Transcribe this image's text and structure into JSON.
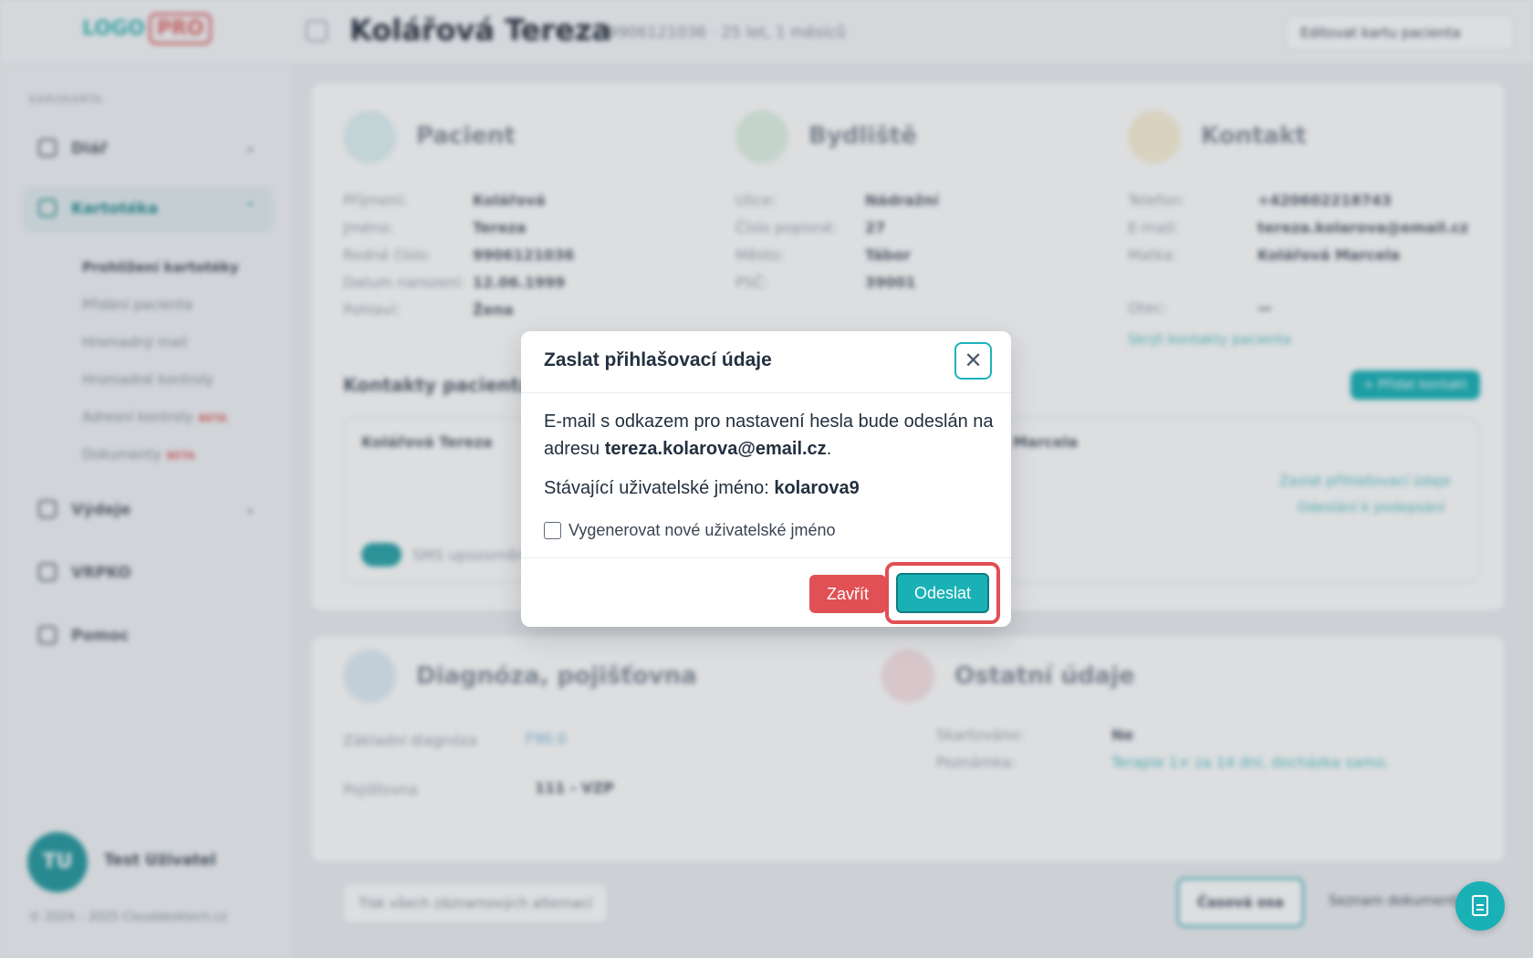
{
  "app": {
    "logo": "LOGO",
    "logo_badge": "PRO",
    "patient_name": "Kolářová Tereza",
    "patient_sub": "9906121036 · 25 let, 1 měsíců",
    "edit_button": "Editovat kartu pacienta"
  },
  "sidebar": {
    "section_label": "KAROKARTA",
    "items": [
      {
        "label": "Diář"
      },
      {
        "label": "Kartotéka"
      },
      {
        "label": "Výdeje"
      },
      {
        "label": "VRPKO"
      },
      {
        "label": "Pomoc"
      }
    ],
    "subitems": [
      {
        "label": "Prohlížení kartotéky"
      },
      {
        "label": "Přidání pacienta"
      },
      {
        "label": "Hromadný mail"
      },
      {
        "label": "Hromadné kontroly"
      },
      {
        "label": "Adresní kontroly",
        "badge": "BETA"
      },
      {
        "label": "Dokumenty",
        "badge": "BETA"
      }
    ],
    "user_initials": "TU",
    "user_name": "Test Uživatel",
    "copyright": "© 2024 – 2025 Clouddesktech.cz"
  },
  "main": {
    "patient_section": {
      "title": "Pacient",
      "rows": [
        {
          "k": "Příjmení:",
          "v": "Kolářová"
        },
        {
          "k": "Jméno:",
          "v": "Tereza"
        },
        {
          "k": "Rodné číslo:",
          "v": "9906121036"
        },
        {
          "k": "Datum narození:",
          "v": "12.06.1999"
        },
        {
          "k": "Pohlaví:",
          "v": "Žena"
        }
      ]
    },
    "address_section": {
      "title": "Bydliště",
      "rows": [
        {
          "k": "Ulice:",
          "v": "Nádražní"
        },
        {
          "k": "Číslo popisné:",
          "v": "27"
        },
        {
          "k": "Město:",
          "v": "Tábor"
        },
        {
          "k": "PSČ:",
          "v": "39001"
        }
      ]
    },
    "contact_section": {
      "title": "Kontakt",
      "rows": [
        {
          "k": "Telefon:",
          "v": "+420602218743"
        },
        {
          "k": "E-mail:",
          "v": "tereza.kolarova@email.cz"
        },
        {
          "k": "Matka:",
          "v": "Kolářová Marcela"
        },
        {
          "k": "Otec:",
          "v": "—"
        }
      ],
      "link": "Skrýt kontakty pacienta"
    },
    "contacts_title": "Kontakty pacienta",
    "add_contact": "+ Přidat kontakt",
    "contact_card_left": "Kolářová Tereza",
    "contact_card_right": "Marcela",
    "link_send_credentials": "Zaslat přihlašovací údaje",
    "link_invitation": "Odeslání k podepsání",
    "sms_label": "SMS upozornění",
    "diagnosis_section": {
      "title": "Diagnóza, pojišťovna",
      "dx_label": "Základní diagnóza",
      "dx_value": "F90.0",
      "ins_label": "Pojišťovna",
      "ins_value": "111 - VZP"
    },
    "other_section": {
      "title": "Ostatní údaje",
      "rows": [
        {
          "k": "Skartováno:",
          "v": "Ne"
        },
        {
          "k": "Poznámka:",
          "v": "Terapie 1× za 14 dní, docházka samo."
        }
      ]
    },
    "bottom_left": "Tisk všech záznamových alternací",
    "bottom_tab_active": "Časová osa",
    "bottom_tab": "Seznam dokumentů"
  },
  "modal": {
    "title": "Zaslat přihlašovací údaje",
    "text_prefix": "E-mail s odkazem pro nastavení hesla bude odeslán na adresu ",
    "email": "tereza.kolarova@email.cz",
    "text_suffix": ".",
    "username_label": "Stávající uživatelské jméno: ",
    "username": "kolarova9",
    "checkbox_label": "Vygenerovat nové uživatelské jméno",
    "close_button": "Zavřít",
    "send_button": "Odeslat"
  },
  "colors": {
    "accent": "#19b1b6",
    "danger": "#e05054"
  }
}
